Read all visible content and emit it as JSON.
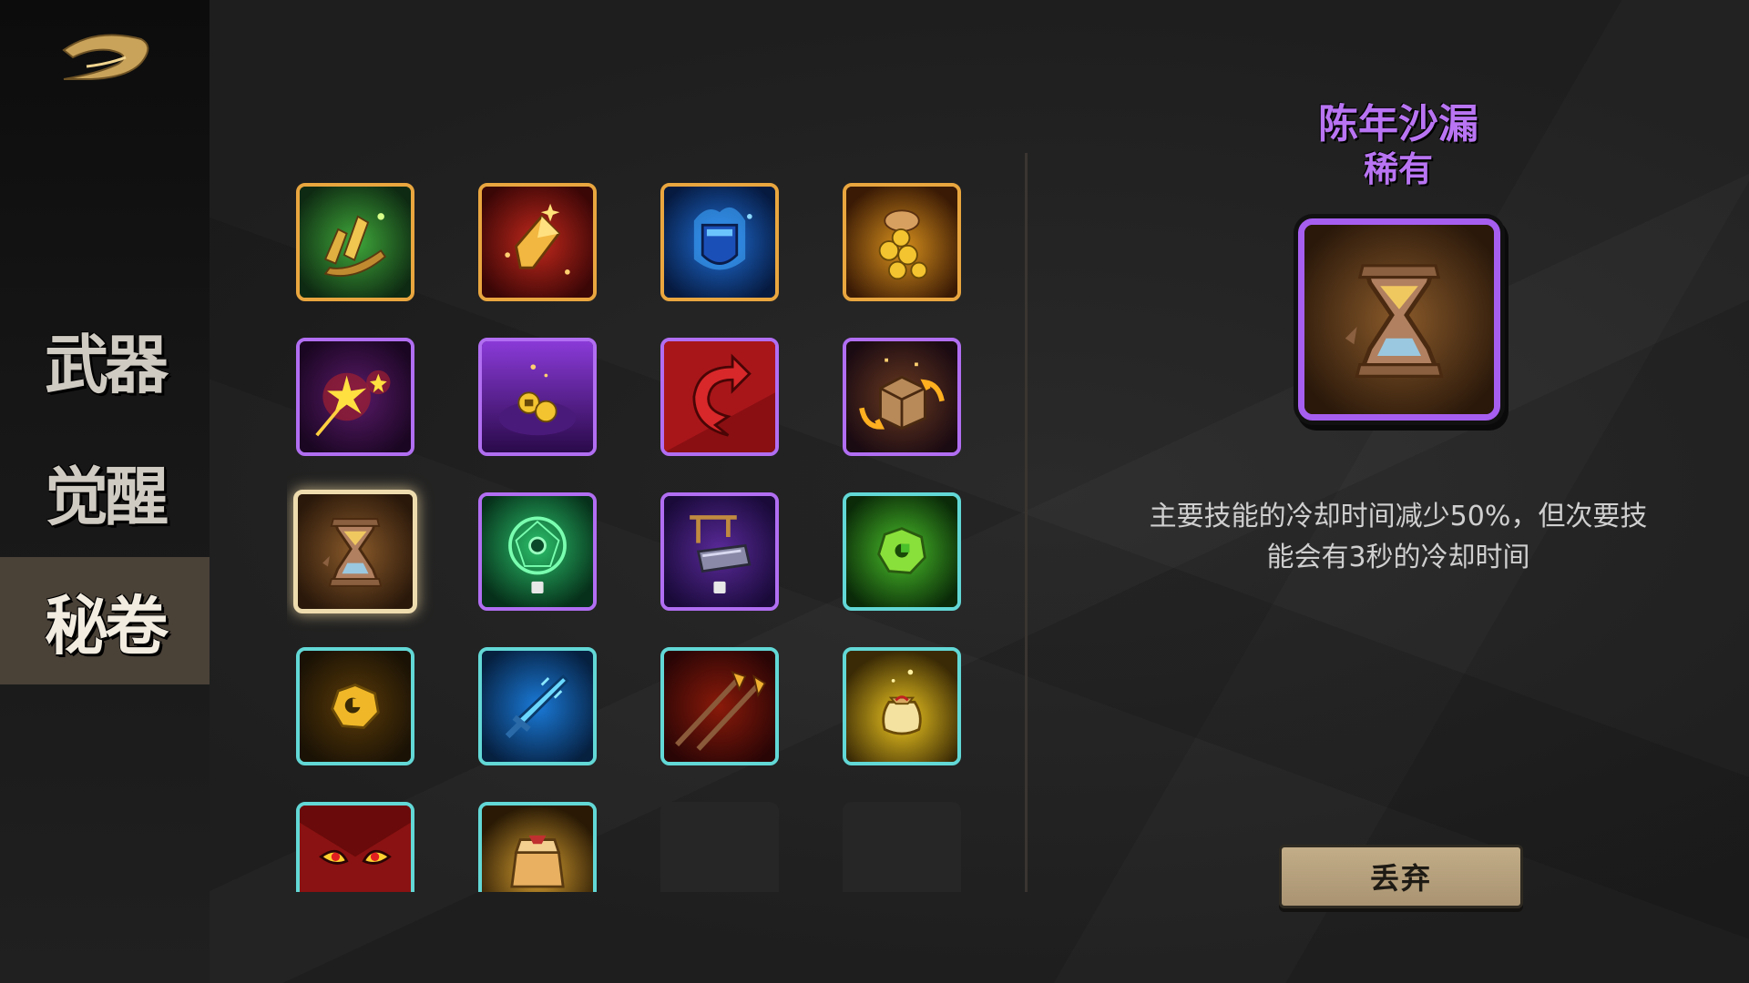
{
  "sidebar": {
    "back_icon": "curved-blade-back-icon",
    "items": [
      {
        "label": "武器",
        "active": false
      },
      {
        "label": "觉醒",
        "active": false
      },
      {
        "label": "秘卷",
        "active": true
      }
    ]
  },
  "grid": {
    "slots": [
      {
        "icon": "golden-bullets-icon",
        "rarity": "gold"
      },
      {
        "icon": "red-crystal-shard-icon",
        "rarity": "gold"
      },
      {
        "icon": "blue-shield-flame-icon",
        "rarity": "gold"
      },
      {
        "icon": "coin-pile-icon",
        "rarity": "gold"
      },
      {
        "icon": "explosion-sparks-icon",
        "rarity": "purple"
      },
      {
        "icon": "coins-spotlight-icon",
        "rarity": "purple"
      },
      {
        "icon": "red-return-arrow-icon",
        "rarity": "purple"
      },
      {
        "icon": "rotating-crate-icon",
        "rarity": "purple"
      },
      {
        "icon": "old-hourglass-icon",
        "rarity": "purple",
        "selected": true
      },
      {
        "icon": "green-amulet-locked-icon",
        "rarity": "purple"
      },
      {
        "icon": "anvil-crane-locked-icon",
        "rarity": "purple"
      },
      {
        "icon": "green-gem-coin-icon",
        "rarity": "teal"
      },
      {
        "icon": "gold-gem-coin-icon",
        "rarity": "teal"
      },
      {
        "icon": "blue-sword-icon",
        "rarity": "teal"
      },
      {
        "icon": "twin-spears-icon",
        "rarity": "teal"
      },
      {
        "icon": "treasure-bag-icon",
        "rarity": "teal"
      },
      {
        "icon": "demon-eyes-icon",
        "rarity": "teal"
      },
      {
        "icon": "treasure-chest-icon",
        "rarity": "teal"
      },
      {
        "icon": "",
        "rarity": "empty"
      },
      {
        "icon": "",
        "rarity": "empty"
      }
    ]
  },
  "detail": {
    "name": "陈年沙漏",
    "rarity": "稀有",
    "icon": "old-hourglass-icon",
    "description_line1": "主要技能的冷却时间减少50%，但次要技",
    "description_line2": "能会有3秒的冷却时间",
    "discard_label": "丢弃"
  },
  "colors": {
    "gold_border": "#e9a63f",
    "purple_border": "#b16ef2",
    "teal_border": "#62d8d6",
    "rare_text": "#b874f2",
    "active_tab_bg": "#4a4137"
  }
}
